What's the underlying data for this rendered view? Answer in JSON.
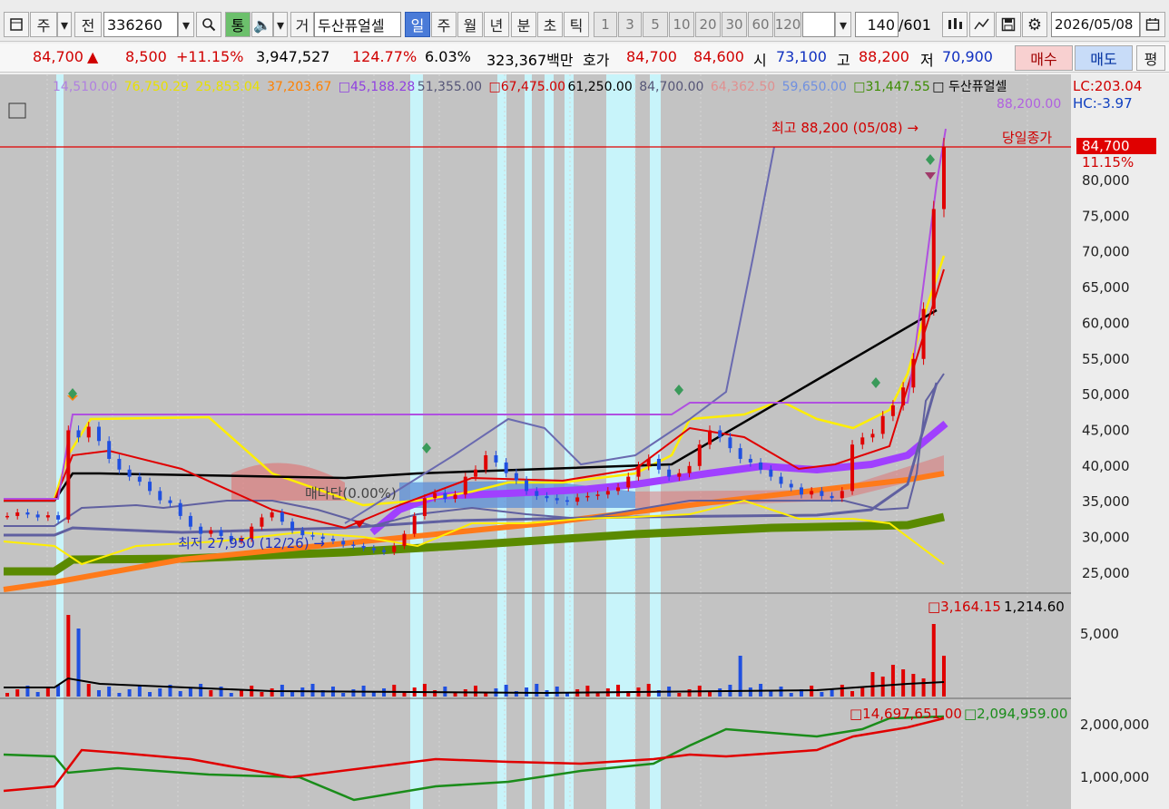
{
  "toolbar": {
    "market_btn": "주",
    "prev_btn": "전",
    "code": "336260",
    "tong": "통",
    "name_prefix": "거",
    "stock_name": "두산퓨얼셀",
    "periods": [
      "일",
      "주",
      "월",
      "년",
      "분",
      "초",
      "틱"
    ],
    "active_period": "일",
    "intervals": [
      "1",
      "3",
      "5",
      "10",
      "20",
      "30",
      "60",
      "120"
    ],
    "count": "140",
    "total": "/601",
    "date": "2026/05/08"
  },
  "quote": {
    "price": "84,700",
    "arrow": "▲",
    "change": "8,500",
    "change_pct": "+11.15%",
    "volume": "3,947,527",
    "vol_ratio": "124.77%",
    "turnover": "6.03%",
    "amount": "323,367백만",
    "hoga_label": "호가",
    "ask": "84,700",
    "bid": "84,600",
    "open_label": "시",
    "open": "73,100",
    "high_label": "고",
    "high": "88,200",
    "low_label": "저",
    "low": "70,900",
    "buy_btn": "매수",
    "sell_btn": "매도",
    "eval_btn": "평"
  },
  "legend": [
    {
      "text": "14,510.00",
      "color": "#b080e0"
    },
    {
      "text": "76,750.29",
      "color": "#e8e000"
    },
    {
      "text": "25,853.04",
      "color": "#e8e000"
    },
    {
      "text": "37,203.67",
      "color": "#ff8000"
    },
    {
      "text": "□45,188.28",
      "color": "#9040e0"
    },
    {
      "text": "51,355.00",
      "color": "#555577"
    },
    {
      "text": "□67,475.00",
      "color": "#d00000"
    },
    {
      "text": "61,250.00",
      "color": "#000000"
    },
    {
      "text": "84,700.00",
      "color": "#555577"
    },
    {
      "text": "64,362.50",
      "color": "#e09090"
    },
    {
      "text": "59,650.00",
      "color": "#7090e0"
    },
    {
      "text": "□31,447.55",
      "color": "#3c8c00"
    },
    {
      "text": "□ 두산퓨얼셀",
      "color": "#000000"
    }
  ],
  "legend2": "88,200.00",
  "lc_label": "LC:203.04",
  "hc_label": "HC:-3.97",
  "max_note": "최고 88,200 (05/08) →",
  "min_note": "최저 27,950 (12/26) →",
  "ichimoku_note": "매다단(0.00%)",
  "close_tag": "당일종가",
  "price_tag": "84,700",
  "pct_tag": "11.15%",
  "price_axis": [
    "80,000",
    "75,000",
    "70,000",
    "65,000",
    "60,000",
    "55,000",
    "50,000",
    "45,000",
    "40,000",
    "35,000",
    "30,000",
    "25,000"
  ],
  "volume_legend": {
    "v1": "□3,164.15",
    "v2": "1,214.60"
  },
  "volume_axis": [
    "5,000"
  ],
  "obv_legend": {
    "v1": "□14,697,651.00",
    "v2": "□2,094,959.00"
  },
  "obv_axis": [
    "2,000,000",
    "1,000,000"
  ],
  "colors": {
    "up": "#e00000",
    "down": "#2050e0",
    "bg": "#c0c0c0",
    "highlight": "#c8f4fa"
  },
  "chart_data": {
    "type": "line",
    "price_range": [
      22500,
      90000
    ],
    "close": [
      33000,
      33500,
      33200,
      32800,
      33100,
      32500,
      45000,
      44000,
      45500,
      43500,
      41000,
      39500,
      38500,
      37800,
      36500,
      35200,
      34800,
      33000,
      31500,
      30500,
      31000,
      30200,
      29500,
      29800,
      31500,
      32800,
      33500,
      32200,
      31000,
      30300,
      30100,
      29800,
      29500,
      29000,
      28800,
      28500,
      28200,
      27950,
      28800,
      30500,
      33000,
      35500,
      36200,
      35400,
      36000,
      38500,
      39500,
      41500,
      40500,
      39000,
      38000,
      36500,
      35800,
      35500,
      35200,
      35000,
      35600,
      35800,
      36000,
      36500,
      37000,
      38500,
      40000,
      41000,
      39500,
      38500,
      39000,
      40000,
      43000,
      45000,
      44000,
      42500,
      41000,
      40500,
      39500,
      38500,
      37500,
      37000,
      36000,
      36500,
      35800,
      35500,
      36500,
      43000,
      44000,
      44500,
      47000,
      48500,
      51000,
      55000,
      62000,
      76000,
      84700
    ]
  }
}
